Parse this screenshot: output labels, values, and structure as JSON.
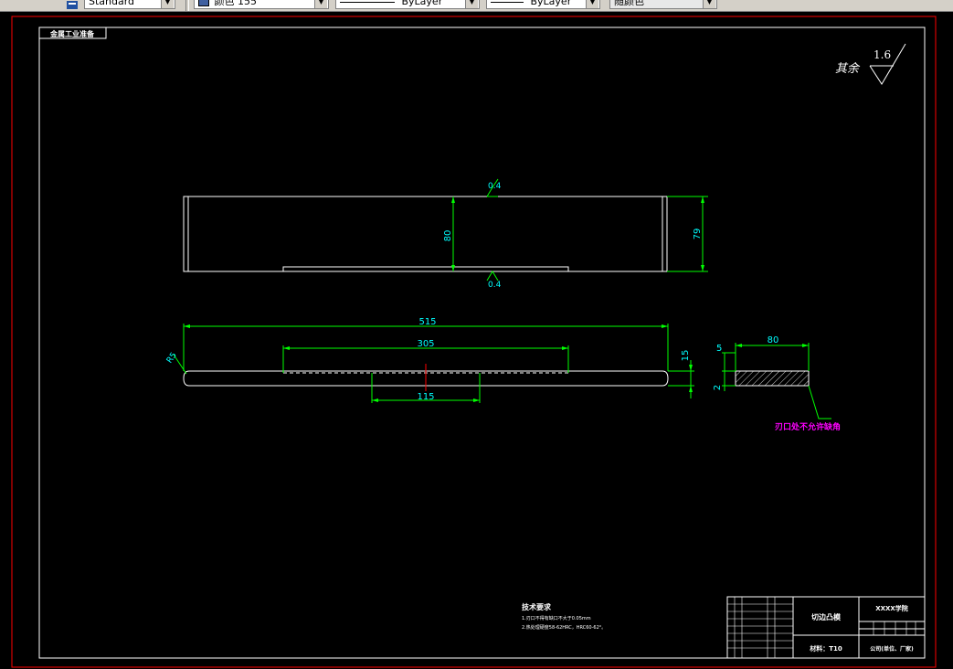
{
  "toolbar": {
    "text_style": "Standard",
    "color": "颜色 155",
    "linetype": "ByLayer",
    "lineweight": "ByLayer",
    "plot_style": "随颜色"
  },
  "drawing": {
    "top_left_label": "金属工业准备",
    "roughness_prefix": "其余",
    "roughness_value": "1.6",
    "top_view": {
      "dim_height_inner": "80",
      "dim_height_outer": "79",
      "parallel_top": "0.4",
      "parallel_bottom": "0.4"
    },
    "front_view": {
      "dim_length": "515",
      "dim_inner": "305",
      "dim_slot": "115",
      "dim_thickness": "15",
      "dim_radius": "R5"
    },
    "section_view": {
      "dim_width": "80",
      "dim_offset": "5",
      "dim_height": "2",
      "note": "刃口处不允许缺角"
    },
    "tech_req": {
      "title": "技术要求",
      "line1": "1.刃口不得有缺口不大于0.05mm",
      "line2": "2.热处理硬度58-62HRC，HRC60-62°。"
    },
    "title_block": {
      "part_name": "切边凸模",
      "drawing_no": "XXXX学院",
      "material": "材料：T10",
      "company": "公司(单位、厂家)"
    }
  },
  "colors": {
    "background": "#000000",
    "geometry": "#ffffff",
    "dimension": "#00ff00",
    "dimension_text": "#00ffff",
    "border": "#ff0000",
    "annotation": "#ff00ff",
    "hatch": "#ffffff",
    "centerline": "#ff0000"
  }
}
